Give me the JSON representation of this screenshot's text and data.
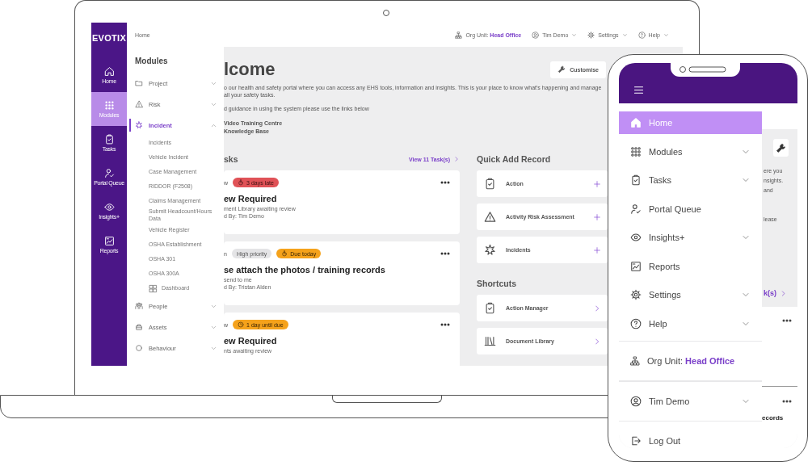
{
  "laptop": {
    "rail": {
      "logo": "EVOTIX",
      "items": [
        {
          "label": "Home",
          "selected": false
        },
        {
          "label": "Modules",
          "selected": true
        },
        {
          "label": "Tasks",
          "selected": false
        },
        {
          "label": "Portal Queue",
          "selected": false
        },
        {
          "label": "Insights+",
          "selected": false
        },
        {
          "label": "Reports",
          "selected": false
        }
      ]
    },
    "header": {
      "breadcrumb": "Home",
      "org_unit": "Org Unit: **Head Office**",
      "user": "Tim Demo",
      "settings": "Settings",
      "help": "Help"
    },
    "flyout": {
      "title": "Modules",
      "items": [
        {
          "label": "Project",
          "selected": false,
          "expanded": false
        },
        {
          "label": "Risk",
          "selected": false,
          "expanded": false
        },
        {
          "label": "Incident",
          "selected": true,
          "expanded": true,
          "children": [
            {
              "label": "Incidents",
              "kind": "page"
            },
            {
              "label": "Vehicle Incident",
              "kind": "page"
            },
            {
              "label": "Case Management",
              "kind": "page"
            },
            {
              "label": "RIDDOR (F2508)",
              "kind": "page"
            },
            {
              "label": "Claims Management",
              "kind": "page"
            },
            {
              "label": "Submit Headcount/Hours Data",
              "kind": "page"
            },
            {
              "label": "Vehicle Register",
              "kind": "page"
            },
            {
              "label": "OSHA Establishment",
              "kind": "page"
            },
            {
              "label": "OSHA 301",
              "kind": "page"
            },
            {
              "label": "OSHA 300A",
              "kind": "page"
            },
            {
              "label": "Dashboard",
              "kind": "dashboard"
            }
          ]
        },
        {
          "label": "People",
          "selected": false,
          "expanded": false
        },
        {
          "label": "Assets",
          "selected": false,
          "expanded": false
        },
        {
          "label": "Behaviour",
          "selected": false,
          "expanded": false
        }
      ]
    },
    "main": {
      "title": "lcome",
      "customise": "Customise",
      "intro": [
        "o our health and safety portal where you can access any EHS tools, information and insights. This is your place to know what's happening and manage all your safety tasks.",
        "d guidance in using the system please use the links below"
      ],
      "links": [
        "Video Training Centre",
        "Knowledge Base"
      ],
      "tasks_title": "sks",
      "view_all": "View 11 Task(s)",
      "tasks": [
        {
          "label": "w",
          "badges": [
            {
              "label": "3 days late",
              "kind": "overdue"
            }
          ],
          "title": "ew Required",
          "lines": [
            "ment Library awaiting review",
            "d By: Tim Demo"
          ]
        },
        {
          "label": "n",
          "badges": [
            {
              "label": "High priority",
              "kind": "priority"
            },
            {
              "label": "Due today",
              "kind": "due"
            }
          ],
          "title": "se attach the photos / training records",
          "lines": [
            "send to me",
            "d By: Tristan Alden"
          ]
        },
        {
          "label": "w",
          "badges": [
            {
              "label": "1 day until due",
              "kind": "upcoming"
            }
          ],
          "title": "ew Required",
          "lines": [
            "nts awaiting review"
          ]
        }
      ],
      "quick_add": {
        "title": "Quick Add Record",
        "items": [
          "Action",
          "Activity Risk Assessment",
          "Incidents"
        ]
      },
      "shortcuts": {
        "title": "Shortcuts",
        "items": [
          "Action Manager",
          "Document Library"
        ]
      }
    }
  },
  "phone": {
    "menu": [
      {
        "label": "Home",
        "selected": true,
        "kind": "link"
      },
      {
        "label": "Modules",
        "selected": false,
        "kind": "group"
      },
      {
        "label": "Tasks",
        "selected": false,
        "kind": "group"
      },
      {
        "label": "Portal Queue",
        "selected": false,
        "kind": "link"
      },
      {
        "label": "Insights+",
        "selected": false,
        "kind": "group"
      },
      {
        "label": "Reports",
        "selected": false,
        "kind": "link"
      },
      {
        "label": "Settings",
        "selected": false,
        "kind": "group"
      },
      {
        "label": "Help",
        "selected": false,
        "kind": "group"
      }
    ],
    "org_unit": "Org Unit: **Head Office**",
    "user": "Tim Demo",
    "logout": "Log Out",
    "behind": {
      "lines": [
        "ere you",
        "nsights.",
        "and"
      ],
      "line_2": "lease",
      "view_all": "k(s)",
      "card_text": "ecords"
    }
  }
}
